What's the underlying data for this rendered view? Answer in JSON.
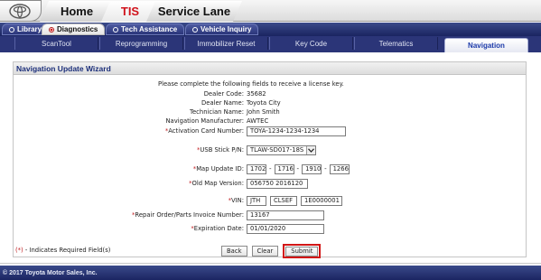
{
  "top_tabs": [
    {
      "label": "Home",
      "active": false
    },
    {
      "label": "TIS",
      "active": true
    },
    {
      "label": "Service Lane",
      "active": false
    }
  ],
  "second_tabs": [
    {
      "label": "Library",
      "active": false
    },
    {
      "label": "Diagnostics",
      "active": true
    },
    {
      "label": "Tech Assistance",
      "active": false
    },
    {
      "label": "Vehicle Inquiry",
      "active": false
    }
  ],
  "sub_tabs": [
    {
      "label": "ScanTool",
      "active": false
    },
    {
      "label": "Reprogramming",
      "active": false
    },
    {
      "label": "Immobilizer Reset",
      "active": false
    },
    {
      "label": "Key Code",
      "active": false
    },
    {
      "label": "Telematics",
      "active": false
    },
    {
      "label": "Navigation",
      "active": true
    }
  ],
  "wizard": {
    "title": "Navigation Update Wizard",
    "intro": "Please complete the following fields to receive a license key.",
    "dealer_code_label": "Dealer Code:",
    "dealer_code": "35682",
    "dealer_name_label": "Dealer Name:",
    "dealer_name": "Toyota City",
    "technician_label": "Technician Name:",
    "technician": "John Smith",
    "manufacturer_label": "Navigation Manufacturer:",
    "manufacturer": "AWTEC",
    "activation_label": "Activation Card Number:",
    "activation_value": "TOYA-1234-1234-1234",
    "usb_label": "USB Stick P/N:",
    "usb_value": "TLAW-SD017-18S",
    "map_update_label": "Map Update ID:",
    "map_update_parts": [
      "1702",
      "1716",
      "1910",
      "1266"
    ],
    "old_map_label": "Old Map Version:",
    "old_map_value": "056750 2016120",
    "vin_label": "VIN:",
    "vin_parts": [
      "JTH",
      "CLSEF",
      "1E0000001"
    ],
    "repair_order_label": "Repair Order/Parts Invoice Number:",
    "repair_order_value": "13167",
    "expiration_label": "Expiration Date:",
    "expiration_value": "01/01/2020",
    "required_star": "(*)",
    "required_text": " - Indicates Required Field(s)",
    "star": "*",
    "dash": "-"
  },
  "buttons": {
    "back": "Back",
    "clear": "Clear",
    "submit": "Submit"
  },
  "footer": "© 2017 Toyota Motor Sales, Inc.",
  "colors": {
    "brand_red": "#d0121b",
    "nav_blue": "#2b3578",
    "required_red": "#c12124",
    "highlight_red": "#d21616"
  }
}
